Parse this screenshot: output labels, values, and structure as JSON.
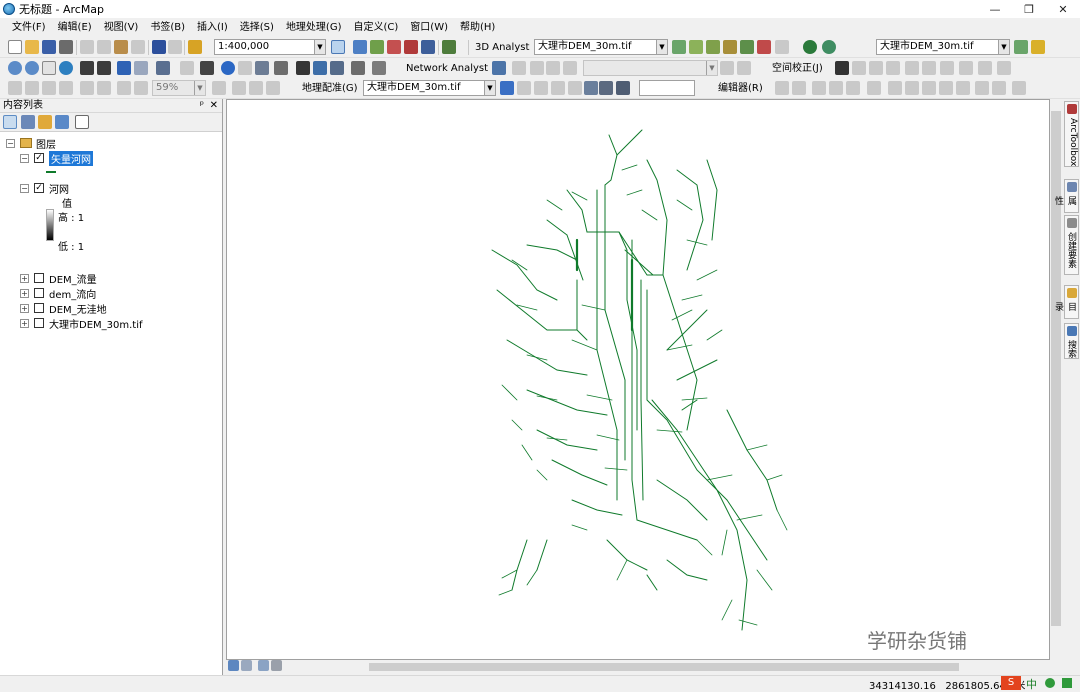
{
  "window": {
    "title": "无标题 - ArcMap",
    "min": "—",
    "restore": "❐",
    "close": "✕"
  },
  "menu": [
    "文件(F)",
    "编辑(E)",
    "视图(V)",
    "书签(B)",
    "插入(I)",
    "选择(S)",
    "地理处理(G)",
    "自定义(C)",
    "窗口(W)",
    "帮助(H)"
  ],
  "toolbar1": {
    "scale": "1:400,000",
    "analyst3d_label": "3D Analyst",
    "analyst3d_layer": "大理市DEM_30m.tif",
    "layer_combo2": "大理市DEM_30m.tif"
  },
  "toolbar2": {
    "zoom_percent": "59%",
    "network_label": "Network Analyst",
    "spatial_adj": "空间校正(J)"
  },
  "toolbar3": {
    "georef_label": "地理配准(G)",
    "georef_layer": "大理市DEM_30m.tif",
    "editor_label": "编辑器(R)"
  },
  "toc": {
    "title": "内容列表",
    "pin": "ᵖ",
    "close": "✕",
    "layers_group": "图层",
    "items": [
      {
        "name": "矢量河网",
        "checked": true,
        "selected": true
      },
      {
        "name": "河网",
        "checked": true,
        "legend_title": "值",
        "high": "高 : 1",
        "low": "低 : 1"
      },
      {
        "name": "DEM_流量",
        "checked": false
      },
      {
        "name": "dem_流向",
        "checked": false
      },
      {
        "name": "DEM_无洼地",
        "checked": false
      },
      {
        "name": "大理市DEM_30m.tif",
        "checked": false
      }
    ]
  },
  "right_tabs": [
    "ArcToolbox",
    "属性",
    "创建要素",
    "目录",
    "搜索"
  ],
  "status": {
    "x": "34314130.16",
    "y": "2861805.648",
    "unit": "米"
  },
  "watermark": "学研杂货铺",
  "ime": {
    "lang": "中"
  },
  "colors": {
    "river": "#0f7a2b",
    "selection": "#1e78d7"
  }
}
